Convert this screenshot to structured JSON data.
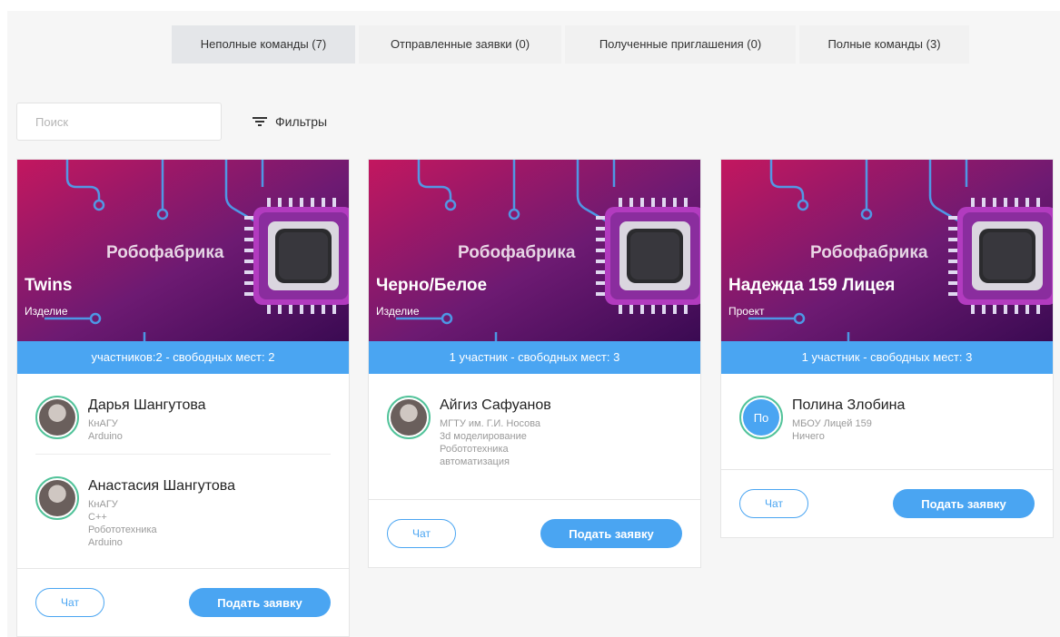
{
  "colors": {
    "accent": "#4aa5f2",
    "avatar_ring": "#52c39a",
    "banner_start": "#c3175f",
    "banner_end": "#3a0a52"
  },
  "tabs": [
    {
      "label": "Неполные команды (7)",
      "active": true
    },
    {
      "label": "Отправленные заявки (0)",
      "active": false
    },
    {
      "label": "Полученные приглашения (0)",
      "active": false
    },
    {
      "label": "Полные команды (3)",
      "active": false
    }
  ],
  "search": {
    "placeholder": "Поиск",
    "value": ""
  },
  "filters": {
    "label": "Фильтры",
    "icon": "filter-icon"
  },
  "cards": [
    {
      "brand": "Робофабрика",
      "name": "Twins",
      "type": "Изделие",
      "seats": "участников:2 - свободных мест: 2",
      "members": [
        {
          "name": "Дарья Шангутова",
          "lines": [
            "КнАГУ",
            "Arduino"
          ],
          "avatar": "photo"
        },
        {
          "name": "Анастасия Шангутова",
          "lines": [
            "КнАГУ",
            "C++",
            "Робототехника",
            "Arduino"
          ],
          "avatar": "photo"
        }
      ],
      "chat_label": "Чат",
      "apply_label": "Подать заявку"
    },
    {
      "brand": "Робофабрика",
      "name": "Черно/Белое",
      "type": "Изделие",
      "seats": "1 участник - свободных мест: 3",
      "members": [
        {
          "name": "Айгиз Сафуанов",
          "lines": [
            "МГТУ им. Г.И. Носова",
            "3d моделирование",
            "Робототехника",
            "автоматизация"
          ],
          "avatar": "photo"
        }
      ],
      "chat_label": "Чат",
      "apply_label": "Подать заявку"
    },
    {
      "brand": "Робофабрика",
      "name": "Надежда 159 Лицея",
      "type": "Проект",
      "seats": "1 участник - свободных мест: 3",
      "members": [
        {
          "name": "Полина Злобина",
          "lines": [
            "МБОУ Лицей 159",
            "Ничего"
          ],
          "avatar": "initials",
          "initials": "По"
        }
      ],
      "chat_label": "Чат",
      "apply_label": "Подать заявку"
    }
  ]
}
